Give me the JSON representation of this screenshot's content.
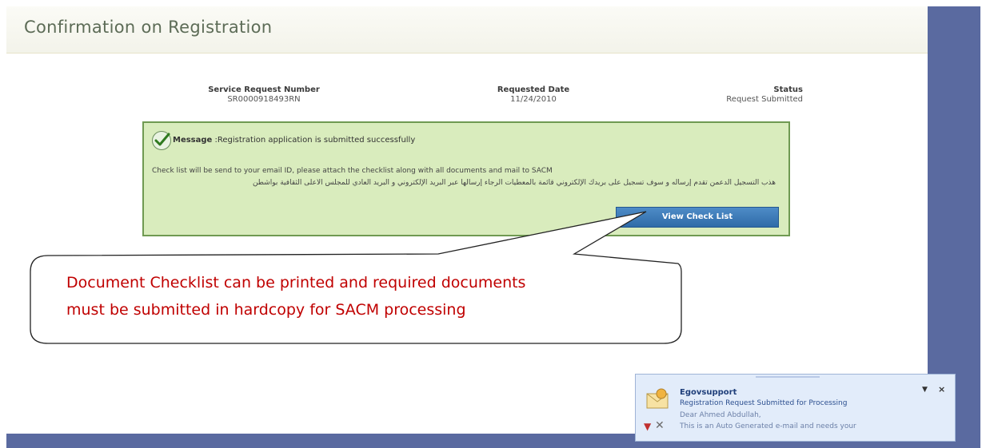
{
  "page": {
    "title": "Confirmation on Registration"
  },
  "request_info": {
    "service_request_number_label": "Service Request Number",
    "service_request_number": "SR0000918493RN",
    "requested_date_label": "Requested Date",
    "requested_date": "11/24/2010",
    "status_label": "Status",
    "status": "Request Submitted"
  },
  "message_box": {
    "title": "Message",
    "text": ":Registration application is submitted successfully",
    "english_note": "Check list will be send to your email ID, please attach the checklist along with all documents and mail to SACM",
    "arabic_note": "هذب التسجيل الدعمن تقدم إرساله و سوف تسجيل على بريدك الإلكتروني قائمة بالمعطيات الرجاء إرسالها عبر البريد الإلكتروني و البريد العادي للمجلس الأعلى الثقافية بواشطن",
    "button_label": "View Check List"
  },
  "callout": {
    "line1": "Document Checklist can be printed and required documents",
    "line2": "must be submitted in hardcopy for SACM processing"
  },
  "notification": {
    "sender": "Egovsupport",
    "subject": "Registration Request Submitted for Processing",
    "body_line1": "Dear Ahmed Abdullah,",
    "body_line2": "This is an Auto Generated e-mail and needs your",
    "menu_icon": "dropdown-arrow-icon",
    "close_icon": "close-icon"
  },
  "colors": {
    "message_bg": "#d9ecbd",
    "message_border": "#6f9a52",
    "button_bg": "#3a78b8",
    "callout_text": "#c00000",
    "side_strip": "#5a6aa0"
  }
}
